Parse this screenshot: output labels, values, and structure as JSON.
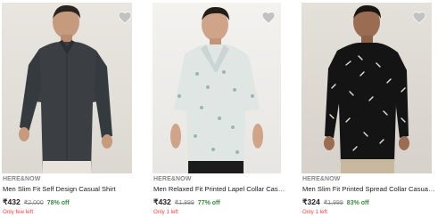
{
  "products": [
    {
      "brand": "HERE&NOW",
      "title": "Men Slim Fit Self Design Casual Shirt",
      "price": "₹432",
      "mrp": "₹2,000",
      "discount": "78% off",
      "stock": "Only few left",
      "wishlist_icon": "heart-icon"
    },
    {
      "brand": "HERE&NOW",
      "title": "Men Relaxed Fit Printed Lapel Collar Casual S...",
      "price": "₹432",
      "mrp": "₹1,899",
      "discount": "77% off",
      "stock": "Only 1 left",
      "wishlist_icon": "heart-icon"
    },
    {
      "brand": "HERE&NOW",
      "title": "Men Slim Fit Printed Spread Collar Casual Shirt",
      "price": "₹324",
      "mrp": "₹1,999",
      "discount": "83% off",
      "stock": "Only 1 left",
      "wishlist_icon": "heart-icon"
    }
  ],
  "colors": {
    "discount": "#388e3c",
    "stock": "#ff3e3e",
    "muted": "#878787"
  }
}
